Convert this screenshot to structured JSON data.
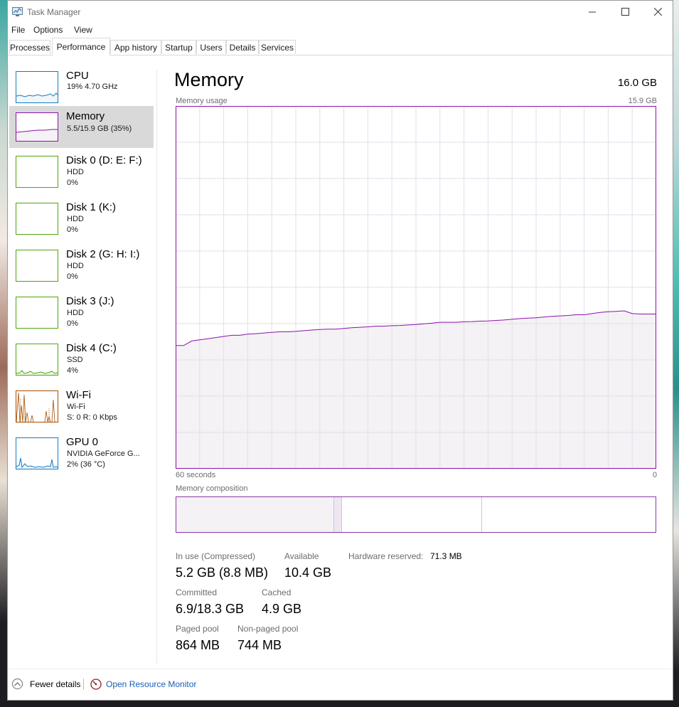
{
  "window": {
    "title": "Task Manager"
  },
  "menu": [
    "File",
    "Options",
    "View"
  ],
  "tabs": [
    "Processes",
    "Performance",
    "App history",
    "Startup",
    "Users",
    "Details",
    "Services"
  ],
  "active_tab": "Performance",
  "sidebar": [
    {
      "name": "CPU",
      "lines": [
        "19% 4.70 GHz"
      ],
      "color": "#117dbb",
      "selected": false
    },
    {
      "name": "Memory",
      "lines": [
        "5.5/15.9 GB (35%)"
      ],
      "color": "#8b12ae",
      "selected": true
    },
    {
      "name": "Disk 0 (D: E: F:)",
      "lines": [
        "HDD",
        "0%"
      ],
      "color": "#4da60c",
      "selected": false
    },
    {
      "name": "Disk 1 (K:)",
      "lines": [
        "HDD",
        "0%"
      ],
      "color": "#4da60c",
      "selected": false
    },
    {
      "name": "Disk 2 (G: H: I:)",
      "lines": [
        "HDD",
        "0%"
      ],
      "color": "#4da60c",
      "selected": false
    },
    {
      "name": "Disk 3 (J:)",
      "lines": [
        "HDD",
        "0%"
      ],
      "color": "#4da60c",
      "selected": false
    },
    {
      "name": "Disk 4 (C:)",
      "lines": [
        "SSD",
        "4%"
      ],
      "color": "#4da60c",
      "selected": false
    },
    {
      "name": "Wi-Fi",
      "lines": [
        "Wi-Fi",
        "S: 0 R: 0 Kbps"
      ],
      "color": "#a74f01",
      "selected": false
    },
    {
      "name": "GPU 0",
      "lines": [
        "NVIDIA GeForce G...",
        "2% (36 °C)"
      ],
      "color": "#117dbb",
      "selected": false
    }
  ],
  "main": {
    "title": "Memory",
    "total": "16.0 GB",
    "usage_label": "Memory usage",
    "usage_max": "15.9 GB",
    "x_left": "60 seconds",
    "x_right": "0",
    "composition_label": "Memory composition"
  },
  "stats": {
    "in_use_label": "In use (Compressed)",
    "in_use_value": "5.2 GB (8.8 MB)",
    "available_label": "Available",
    "available_value": "10.4 GB",
    "hw_reserved_label": "Hardware reserved:",
    "hw_reserved_value": "71.3 MB",
    "committed_label": "Committed",
    "committed_value": "6.9/18.3 GB",
    "cached_label": "Cached",
    "cached_value": "4.9 GB",
    "paged_label": "Paged pool",
    "paged_value": "864 MB",
    "nonpaged_label": "Non-paged pool",
    "nonpaged_value": "744 MB"
  },
  "footer": {
    "fewer_details": "Fewer details",
    "open_resmon": "Open Resource Monitor"
  },
  "colors": {
    "memory": "#8b12ae",
    "memory_fill": "#f4f2f4",
    "grid": "#e6dceb",
    "link": "#1a5fb4"
  },
  "chart_data": {
    "type": "area",
    "title": "Memory usage",
    "xlabel": "",
    "ylabel": "",
    "x_range_seconds": [
      60,
      0
    ],
    "ylim": [
      0,
      15.9
    ],
    "grid": true,
    "series": [
      {
        "values": [
          5.4,
          5.4,
          5.6,
          5.65,
          5.7,
          5.75,
          5.8,
          5.85,
          5.85,
          5.9,
          5.92,
          5.95,
          5.98,
          6.0,
          6.0,
          6.02,
          6.05,
          6.08,
          6.1,
          6.12,
          6.12,
          6.15,
          6.18,
          6.2,
          6.22,
          6.25,
          6.25,
          6.27,
          6.28,
          6.3,
          6.32,
          6.35,
          6.38,
          6.42,
          6.42,
          6.42,
          6.44,
          6.45,
          6.47,
          6.48,
          6.5,
          6.52,
          6.55,
          6.58,
          6.6,
          6.62,
          6.65,
          6.68,
          6.7,
          6.72,
          6.75,
          6.75,
          6.8,
          6.85,
          6.88,
          6.9,
          6.92,
          6.8,
          6.78,
          6.78,
          6.78
        ]
      }
    ],
    "composition": {
      "in_use": 5.2,
      "modified": 0.25,
      "standby": 4.9,
      "free": 5.55
    }
  }
}
